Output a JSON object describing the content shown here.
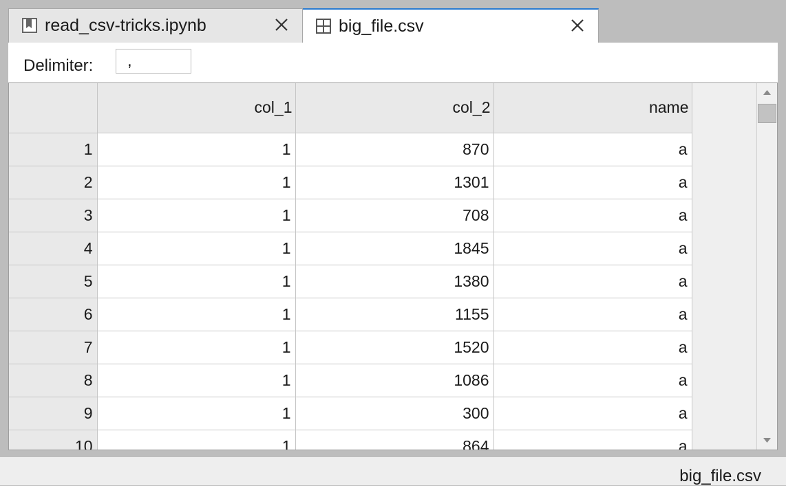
{
  "tabs": [
    {
      "label": "read_csv-tricks.ipynb",
      "icon": "notebook-icon",
      "active": false
    },
    {
      "label": "big_file.csv",
      "icon": "table-grid-icon",
      "active": true
    }
  ],
  "toolbar": {
    "delimiter_label": "Delimiter:",
    "delimiter_value": ","
  },
  "table": {
    "columns": [
      "",
      "col_1",
      "col_2",
      "name"
    ],
    "rows": [
      [
        "1",
        "1",
        "870",
        "a"
      ],
      [
        "2",
        "1",
        "1301",
        "a"
      ],
      [
        "3",
        "1",
        "708",
        "a"
      ],
      [
        "4",
        "1",
        "1845",
        "a"
      ],
      [
        "5",
        "1",
        "1380",
        "a"
      ],
      [
        "6",
        "1",
        "1155",
        "a"
      ],
      [
        "7",
        "1",
        "1520",
        "a"
      ],
      [
        "8",
        "1",
        "1086",
        "a"
      ],
      [
        "9",
        "1",
        "300",
        "a"
      ],
      [
        "10",
        "1",
        "864",
        "a"
      ]
    ]
  },
  "statusbar": {
    "text": "big_file.csv"
  },
  "colors": {
    "active_tab_accent": "#2b7bd0",
    "chrome_gray": "#bdbdbd"
  }
}
